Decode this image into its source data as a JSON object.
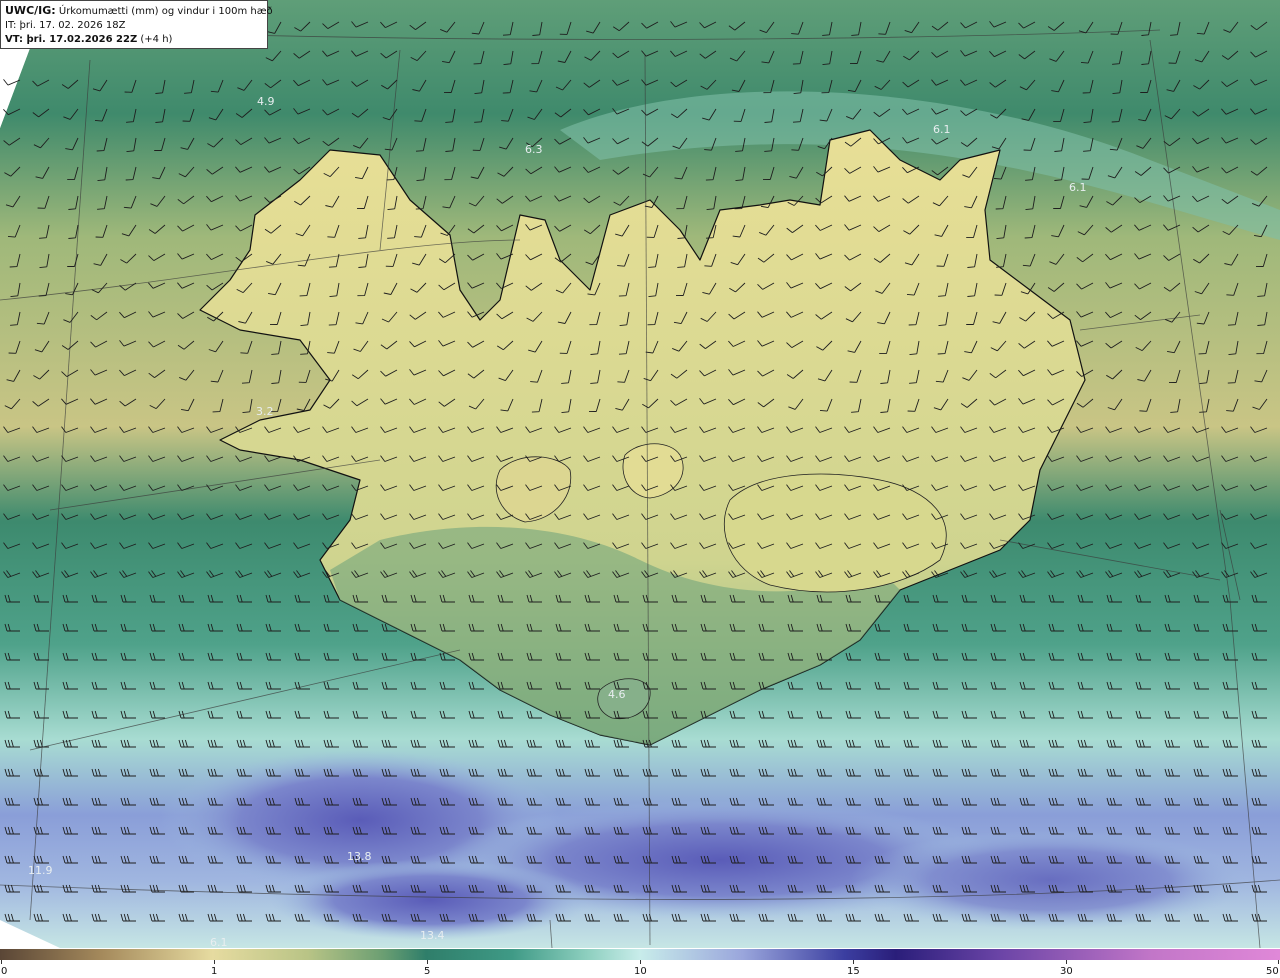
{
  "header": {
    "product": "UWC/IG:",
    "description": "Úrkomumætti (mm) og vindur i 100m hæð",
    "it_label": "IT:",
    "it_value": "þri. 17. 02. 2026 18Z",
    "vt_label": "VT: þri. 17.02.2026 22Z",
    "vt_lead": "(+4 h)"
  },
  "map_labels": [
    {
      "id": "ml-1",
      "text": "4.9"
    },
    {
      "id": "ml-2",
      "text": "6.3"
    },
    {
      "id": "ml-3",
      "text": "6.1"
    },
    {
      "id": "ml-4",
      "text": "6.1"
    },
    {
      "id": "ml-5",
      "text": "3.2"
    },
    {
      "id": "ml-6",
      "text": "4.6"
    },
    {
      "id": "ml-7",
      "text": "13.8"
    },
    {
      "id": "ml-8",
      "text": "11.9"
    },
    {
      "id": "ml-9",
      "text": "6.1"
    },
    {
      "id": "ml-10",
      "text": "13.4"
    }
  ],
  "colorbar": {
    "ticks": [
      "0",
      "1",
      "5",
      "10",
      "15",
      "30",
      "50"
    ],
    "colors": {
      "low": "#5a4636",
      "light": "#e6dba0",
      "mid": "#2f7e6a",
      "pale": "#c8ecea",
      "deep": "#2a1e7a",
      "high": "#e088d8"
    }
  },
  "map_colors": {
    "sea_north": "#4f9a74",
    "land": "#e8df94",
    "sea_south": "#3f8f7a",
    "heavy": "#6f78c8",
    "barb": "#222222",
    "coast": "#111111"
  }
}
